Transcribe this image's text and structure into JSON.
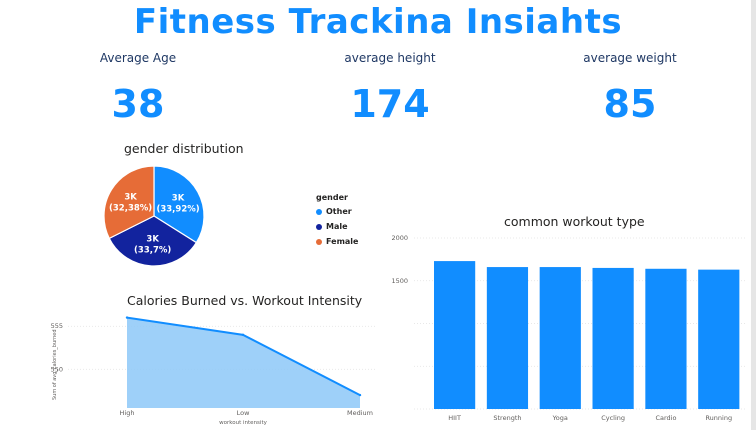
{
  "title": "Fitness Trackina Insiahts",
  "kpis": [
    {
      "label": "Average Age",
      "value": "38"
    },
    {
      "label": "average height",
      "value": "174"
    },
    {
      "label": "average weight",
      "value": "85"
    }
  ],
  "colors": {
    "accent": "#118DFF",
    "navy": "#12239E",
    "orange": "#E66C37",
    "area": "#8DC8F8"
  },
  "pie": {
    "title": "gender distribution",
    "legend_title": "gender",
    "slices": [
      {
        "name": "Other",
        "label": "3K",
        "pct": "(33,92%)",
        "value": 33.92,
        "color": "#118DFF"
      },
      {
        "name": "Male",
        "label": "3K",
        "pct": "(33,7%)",
        "value": 33.7,
        "color": "#12239E"
      },
      {
        "name": "Female",
        "label": "3K",
        "pct": "(32,38%)",
        "value": 32.38,
        "color": "#E66C37"
      }
    ]
  },
  "chart_data": [
    {
      "type": "pie",
      "title": "gender distribution",
      "categories": [
        "Other",
        "Male",
        "Female"
      ],
      "values": [
        33.92,
        33.7,
        32.38
      ]
    },
    {
      "type": "area",
      "title": "Calories Burned vs. Workout Intensity",
      "xlabel": "workout intensity",
      "ylabel": "Sum of avg_calories_burned",
      "categories": [
        "High",
        "Low",
        "Medium"
      ],
      "values": [
        556,
        554,
        547
      ],
      "yticks": [
        "555",
        "550"
      ],
      "grid": true
    },
    {
      "type": "bar",
      "title": "common workout type",
      "categories": [
        "HIIT",
        "Strength",
        "Yoga",
        "Cycling",
        "Cardio",
        "Running"
      ],
      "values": [
        1730,
        1660,
        1660,
        1650,
        1640,
        1630
      ],
      "yticks": [
        "2000",
        "1500"
      ],
      "ylim": [
        0,
        2000
      ],
      "grid": true
    }
  ]
}
